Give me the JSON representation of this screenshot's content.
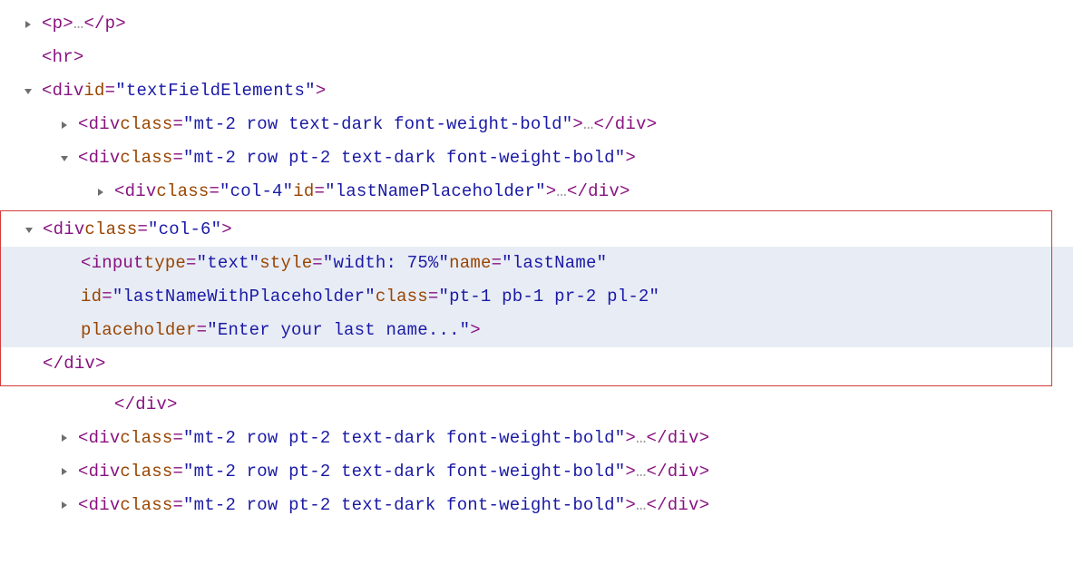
{
  "lines": {
    "l0": {
      "tag": "p",
      "close": "p"
    },
    "l1": {
      "tag": "hr"
    },
    "l2": {
      "tag": "div",
      "id_attr": "id",
      "id_val": "\"textFieldElements\""
    },
    "l3": {
      "tag": "div",
      "class_attr": "class",
      "class_val": "\"mt-2 row text-dark font-weight-bold\"",
      "close": "div"
    },
    "l4": {
      "tag": "div",
      "class_attr": "class",
      "class_val": "\"mt-2 row pt-2 text-dark font-weight-bold\""
    },
    "l5": {
      "tag": "div",
      "class_attr": "class",
      "class_val": "\"col-4\"",
      "id_attr": "id",
      "id_val": "\"lastNamePlaceholder\"",
      "close": "div"
    },
    "l6": {
      "tag": "div",
      "class_attr": "class",
      "class_val": "\"col-6\""
    },
    "l7a": {
      "tag": "input",
      "type_attr": "type",
      "type_val": "\"text\"",
      "style_attr": "style",
      "style_val": "\"width: 75%\"",
      "name_attr": "name",
      "name_val": "\"lastName\""
    },
    "l7b": {
      "id_attr": "id",
      "id_val": "\"lastNameWithPlaceholder\"",
      "class_attr": "class",
      "class_val": "\"pt-1 pb-1 pr-2 pl-2\""
    },
    "l7c": {
      "ph_attr": "placeholder",
      "ph_val": "\"Enter your last name...\""
    },
    "l8": {
      "close": "div"
    },
    "l9": {
      "close": "div"
    },
    "l10": {
      "tag": "div",
      "class_attr": "class",
      "class_val": "\"mt-2 row pt-2 text-dark font-weight-bold\"",
      "close": "div"
    },
    "l11": {
      "tag": "div",
      "class_attr": "class",
      "class_val": "\"mt-2 row pt-2 text-dark font-weight-bold\"",
      "close": "div"
    },
    "l12": {
      "tag": "div",
      "class_attr": "class",
      "class_val": "\"mt-2 row pt-2 text-dark font-weight-bold\"",
      "close": "div"
    }
  },
  "sym": {
    "lt": "<",
    "gt": ">",
    "lt_sl": "</",
    "eq": "=",
    "ellip": "…",
    "sp": " "
  }
}
